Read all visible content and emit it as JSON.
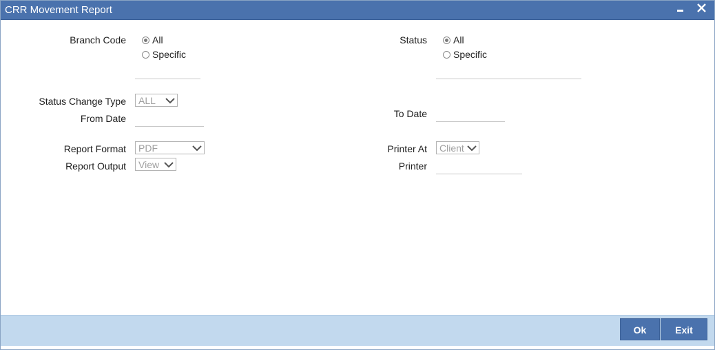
{
  "window": {
    "title": "CRR Movement Report"
  },
  "branch_code": {
    "label": "Branch Code",
    "options": [
      {
        "label": "All",
        "checked": true
      },
      {
        "label": "Specific",
        "checked": false
      }
    ],
    "specific_value": ""
  },
  "status": {
    "label": "Status",
    "options": [
      {
        "label": "All",
        "checked": true
      },
      {
        "label": "Specific",
        "checked": false
      }
    ],
    "specific_value": ""
  },
  "status_change_type": {
    "label": "Status Change Type",
    "value": "ALL"
  },
  "from_date": {
    "label": "From Date",
    "value": ""
  },
  "to_date": {
    "label": "To Date",
    "value": ""
  },
  "report_format": {
    "label": "Report Format",
    "value": "PDF"
  },
  "report_output": {
    "label": "Report Output",
    "value": "View"
  },
  "printer_at": {
    "label": "Printer At",
    "value": "Client"
  },
  "printer": {
    "label": "Printer",
    "value": ""
  },
  "footer": {
    "ok_label": "Ok",
    "exit_label": "Exit"
  },
  "icons": {
    "minimize": "minimize-icon",
    "close": "close-icon",
    "chevron": "chevron-down-icon"
  },
  "colors": {
    "titlebar": "#4a72ad",
    "footer": "#c2d9ee",
    "button": "#4a72ad"
  }
}
